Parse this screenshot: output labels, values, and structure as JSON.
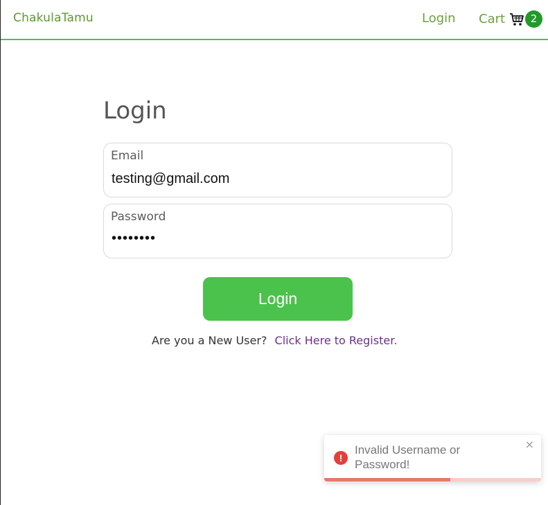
{
  "header": {
    "brand": "ChakulaTamu",
    "login_link": "Login",
    "cart_label": "Cart",
    "cart_icon": "shopping-cart-icon",
    "cart_count": "2"
  },
  "form": {
    "title": "Login",
    "email_label": "Email",
    "email_value": "testing@gmail.com",
    "password_label": "Password",
    "password_value": "••••••••",
    "submit_label": "Login",
    "register_prompt": "Are you a New User?",
    "register_link": "Click Here to Register."
  },
  "toast": {
    "icon": "error-icon",
    "message": "Invalid Username or Password!",
    "close_symbol": "×",
    "progress_fraction": 0.58
  },
  "colors": {
    "accent": "#4bc24b",
    "brand_text": "#5a9a2b",
    "badge": "#219a2a",
    "link_purple": "#6b2f8c",
    "error": "#e3403c"
  }
}
